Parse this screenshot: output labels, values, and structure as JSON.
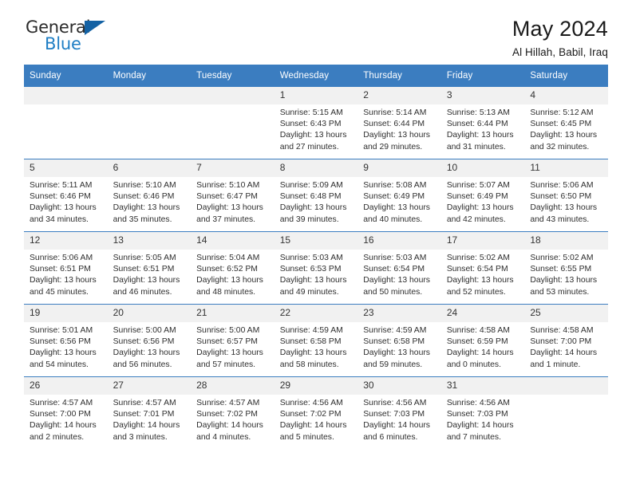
{
  "brand": {
    "name_top": "General",
    "name_bottom": "Blue",
    "triangle_color": "#1462a4",
    "blue_color": "#1f7ec4"
  },
  "header": {
    "title": "May 2024",
    "subtitle": "Al Hillah, Babil, Iraq",
    "header_bg_color": "#3b7dc0",
    "daynum_bg_color": "#f1f1f1"
  },
  "weekdays": [
    "Sunday",
    "Monday",
    "Tuesday",
    "Wednesday",
    "Thursday",
    "Friday",
    "Saturday"
  ],
  "labels": {
    "sunrise_prefix": "Sunrise: ",
    "sunset_prefix": "Sunset: ",
    "daylight_prefix": "Daylight: "
  },
  "weeks": [
    [
      {
        "day": "",
        "blank": true
      },
      {
        "day": "",
        "blank": true
      },
      {
        "day": "",
        "blank": true
      },
      {
        "day": "1",
        "sunrise": "Sunrise: 5:15 AM",
        "sunset": "Sunset: 6:43 PM",
        "daylight1": "Daylight: 13 hours",
        "daylight2": "and 27 minutes."
      },
      {
        "day": "2",
        "sunrise": "Sunrise: 5:14 AM",
        "sunset": "Sunset: 6:44 PM",
        "daylight1": "Daylight: 13 hours",
        "daylight2": "and 29 minutes."
      },
      {
        "day": "3",
        "sunrise": "Sunrise: 5:13 AM",
        "sunset": "Sunset: 6:44 PM",
        "daylight1": "Daylight: 13 hours",
        "daylight2": "and 31 minutes."
      },
      {
        "day": "4",
        "sunrise": "Sunrise: 5:12 AM",
        "sunset": "Sunset: 6:45 PM",
        "daylight1": "Daylight: 13 hours",
        "daylight2": "and 32 minutes."
      }
    ],
    [
      {
        "day": "5",
        "sunrise": "Sunrise: 5:11 AM",
        "sunset": "Sunset: 6:46 PM",
        "daylight1": "Daylight: 13 hours",
        "daylight2": "and 34 minutes."
      },
      {
        "day": "6",
        "sunrise": "Sunrise: 5:10 AM",
        "sunset": "Sunset: 6:46 PM",
        "daylight1": "Daylight: 13 hours",
        "daylight2": "and 35 minutes."
      },
      {
        "day": "7",
        "sunrise": "Sunrise: 5:10 AM",
        "sunset": "Sunset: 6:47 PM",
        "daylight1": "Daylight: 13 hours",
        "daylight2": "and 37 minutes."
      },
      {
        "day": "8",
        "sunrise": "Sunrise: 5:09 AM",
        "sunset": "Sunset: 6:48 PM",
        "daylight1": "Daylight: 13 hours",
        "daylight2": "and 39 minutes."
      },
      {
        "day": "9",
        "sunrise": "Sunrise: 5:08 AM",
        "sunset": "Sunset: 6:49 PM",
        "daylight1": "Daylight: 13 hours",
        "daylight2": "and 40 minutes."
      },
      {
        "day": "10",
        "sunrise": "Sunrise: 5:07 AM",
        "sunset": "Sunset: 6:49 PM",
        "daylight1": "Daylight: 13 hours",
        "daylight2": "and 42 minutes."
      },
      {
        "day": "11",
        "sunrise": "Sunrise: 5:06 AM",
        "sunset": "Sunset: 6:50 PM",
        "daylight1": "Daylight: 13 hours",
        "daylight2": "and 43 minutes."
      }
    ],
    [
      {
        "day": "12",
        "sunrise": "Sunrise: 5:06 AM",
        "sunset": "Sunset: 6:51 PM",
        "daylight1": "Daylight: 13 hours",
        "daylight2": "and 45 minutes."
      },
      {
        "day": "13",
        "sunrise": "Sunrise: 5:05 AM",
        "sunset": "Sunset: 6:51 PM",
        "daylight1": "Daylight: 13 hours",
        "daylight2": "and 46 minutes."
      },
      {
        "day": "14",
        "sunrise": "Sunrise: 5:04 AM",
        "sunset": "Sunset: 6:52 PM",
        "daylight1": "Daylight: 13 hours",
        "daylight2": "and 48 minutes."
      },
      {
        "day": "15",
        "sunrise": "Sunrise: 5:03 AM",
        "sunset": "Sunset: 6:53 PM",
        "daylight1": "Daylight: 13 hours",
        "daylight2": "and 49 minutes."
      },
      {
        "day": "16",
        "sunrise": "Sunrise: 5:03 AM",
        "sunset": "Sunset: 6:54 PM",
        "daylight1": "Daylight: 13 hours",
        "daylight2": "and 50 minutes."
      },
      {
        "day": "17",
        "sunrise": "Sunrise: 5:02 AM",
        "sunset": "Sunset: 6:54 PM",
        "daylight1": "Daylight: 13 hours",
        "daylight2": "and 52 minutes."
      },
      {
        "day": "18",
        "sunrise": "Sunrise: 5:02 AM",
        "sunset": "Sunset: 6:55 PM",
        "daylight1": "Daylight: 13 hours",
        "daylight2": "and 53 minutes."
      }
    ],
    [
      {
        "day": "19",
        "sunrise": "Sunrise: 5:01 AM",
        "sunset": "Sunset: 6:56 PM",
        "daylight1": "Daylight: 13 hours",
        "daylight2": "and 54 minutes."
      },
      {
        "day": "20",
        "sunrise": "Sunrise: 5:00 AM",
        "sunset": "Sunset: 6:56 PM",
        "daylight1": "Daylight: 13 hours",
        "daylight2": "and 56 minutes."
      },
      {
        "day": "21",
        "sunrise": "Sunrise: 5:00 AM",
        "sunset": "Sunset: 6:57 PM",
        "daylight1": "Daylight: 13 hours",
        "daylight2": "and 57 minutes."
      },
      {
        "day": "22",
        "sunrise": "Sunrise: 4:59 AM",
        "sunset": "Sunset: 6:58 PM",
        "daylight1": "Daylight: 13 hours",
        "daylight2": "and 58 minutes."
      },
      {
        "day": "23",
        "sunrise": "Sunrise: 4:59 AM",
        "sunset": "Sunset: 6:58 PM",
        "daylight1": "Daylight: 13 hours",
        "daylight2": "and 59 minutes."
      },
      {
        "day": "24",
        "sunrise": "Sunrise: 4:58 AM",
        "sunset": "Sunset: 6:59 PM",
        "daylight1": "Daylight: 14 hours",
        "daylight2": "and 0 minutes."
      },
      {
        "day": "25",
        "sunrise": "Sunrise: 4:58 AM",
        "sunset": "Sunset: 7:00 PM",
        "daylight1": "Daylight: 14 hours",
        "daylight2": "and 1 minute."
      }
    ],
    [
      {
        "day": "26",
        "sunrise": "Sunrise: 4:57 AM",
        "sunset": "Sunset: 7:00 PM",
        "daylight1": "Daylight: 14 hours",
        "daylight2": "and 2 minutes."
      },
      {
        "day": "27",
        "sunrise": "Sunrise: 4:57 AM",
        "sunset": "Sunset: 7:01 PM",
        "daylight1": "Daylight: 14 hours",
        "daylight2": "and 3 minutes."
      },
      {
        "day": "28",
        "sunrise": "Sunrise: 4:57 AM",
        "sunset": "Sunset: 7:02 PM",
        "daylight1": "Daylight: 14 hours",
        "daylight2": "and 4 minutes."
      },
      {
        "day": "29",
        "sunrise": "Sunrise: 4:56 AM",
        "sunset": "Sunset: 7:02 PM",
        "daylight1": "Daylight: 14 hours",
        "daylight2": "and 5 minutes."
      },
      {
        "day": "30",
        "sunrise": "Sunrise: 4:56 AM",
        "sunset": "Sunset: 7:03 PM",
        "daylight1": "Daylight: 14 hours",
        "daylight2": "and 6 minutes."
      },
      {
        "day": "31",
        "sunrise": "Sunrise: 4:56 AM",
        "sunset": "Sunset: 7:03 PM",
        "daylight1": "Daylight: 14 hours",
        "daylight2": "and 7 minutes."
      },
      {
        "day": "",
        "blank": true
      }
    ]
  ]
}
